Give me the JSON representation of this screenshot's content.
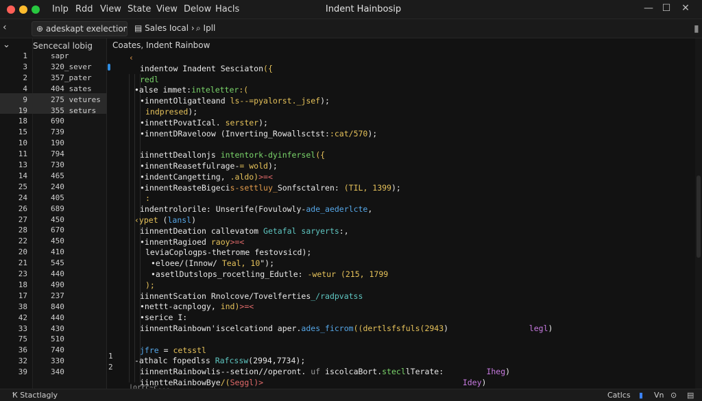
{
  "window": {
    "title": "Indent Hainbosip",
    "controls": {
      "minimize": "—",
      "maximize": "☐",
      "close": "✕"
    }
  },
  "menu": [
    "Inlp",
    "Rdd",
    "View",
    "State",
    "View",
    "Delow",
    "Hacls"
  ],
  "toolbar": {
    "back": "‹",
    "dropdown": "⊕ adeskapt exelection ▾",
    "local": "▤ Sales Iocal ›",
    "call": "⌕ Ipll",
    "right": "▮"
  },
  "sidebar": {
    "header": "Sencecal lobig",
    "chevron": "⌄",
    "rows": [
      {
        "gutter": "1",
        "val": "sapr"
      },
      {
        "gutter": "3",
        "val": "320_sever"
      },
      {
        "gutter": "2",
        "val": "357_pater"
      },
      {
        "gutter": "4",
        "val": "404 sates"
      },
      {
        "gutter": "9",
        "val": "275 vetures"
      },
      {
        "gutter": "19",
        "val": "355 seturs"
      },
      {
        "gutter": "18",
        "val": "690"
      },
      {
        "gutter": "15",
        "val": "739"
      },
      {
        "gutter": "10",
        "val": "190"
      },
      {
        "gutter": "11",
        "val": "794"
      },
      {
        "gutter": "13",
        "val": "730"
      },
      {
        "gutter": "14",
        "val": "465"
      },
      {
        "gutter": "25",
        "val": "240"
      },
      {
        "gutter": "24",
        "val": "405"
      },
      {
        "gutter": "26",
        "val": "689"
      },
      {
        "gutter": "27",
        "val": "450"
      },
      {
        "gutter": "28",
        "val": "670"
      },
      {
        "gutter": "22",
        "val": "450"
      },
      {
        "gutter": "20",
        "val": "410"
      },
      {
        "gutter": "21",
        "val": "545"
      },
      {
        "gutter": "23",
        "val": "440"
      },
      {
        "gutter": "18",
        "val": "490"
      },
      {
        "gutter": "17",
        "val": "237"
      },
      {
        "gutter": "38",
        "val": "840"
      },
      {
        "gutter": "42",
        "val": "440"
      },
      {
        "gutter": "33",
        "val": "430"
      },
      {
        "gutter": "75",
        "val": "510"
      },
      {
        "gutter": "36",
        "val": "740"
      },
      {
        "gutter": "32",
        "val": "330"
      },
      {
        "gutter": "39",
        "val": "340"
      }
    ]
  },
  "editor": {
    "header": "Coates, Indent Rainbow",
    "lines": [
      {
        "indent": 2,
        "parts": [
          {
            "t": "‹",
            "c": "o"
          }
        ]
      },
      {
        "indent": 4,
        "parts": [
          {
            "t": "indentow Inadent Sesciaton",
            "c": "w"
          },
          {
            "t": "({",
            "c": "y"
          }
        ]
      },
      {
        "indent": 4,
        "parts": [
          {
            "t": "redl",
            "c": "g"
          }
        ]
      },
      {
        "indent": 3,
        "parts": [
          {
            "t": "•alse immet:",
            "c": "w"
          },
          {
            "t": "inteletter",
            "c": "g"
          },
          {
            "t": ":(",
            "c": "y"
          }
        ]
      },
      {
        "indent": 4,
        "parts": [
          {
            "t": "•innentOligatleand ",
            "c": "w"
          },
          {
            "t": "ls--=pyalorst._jsef",
            "c": "y"
          },
          {
            "t": ");",
            "c": "w"
          }
        ]
      },
      {
        "indent": 5,
        "parts": [
          {
            "t": "indpresed",
            "c": "y"
          },
          {
            "t": ");",
            "c": "w"
          }
        ]
      },
      {
        "indent": 4,
        "parts": [
          {
            "t": "•innettPovatIcal.",
            "c": "w"
          },
          {
            "t": " serster",
            "c": "y"
          },
          {
            "t": ");",
            "c": "w"
          }
        ]
      },
      {
        "indent": 4,
        "parts": [
          {
            "t": "•innentDRaveloow (Inverting_Rowallsctst:",
            "c": "w"
          },
          {
            "t": ":cat/570",
            "c": "y"
          },
          {
            "t": ");",
            "c": "w"
          }
        ]
      },
      {
        "indent": 0,
        "parts": [
          {
            "t": "",
            "c": "w"
          }
        ]
      },
      {
        "indent": 4,
        "parts": [
          {
            "t": "iinnettDeallonjs ",
            "c": "w"
          },
          {
            "t": "intentork-dyinfersel",
            "c": "g"
          },
          {
            "t": "({",
            "c": "y"
          }
        ]
      },
      {
        "indent": 4,
        "parts": [
          {
            "t": "•innentReasetfulrage-",
            "c": "w"
          },
          {
            "t": "= wold",
            "c": "y"
          },
          {
            "t": ");",
            "c": "w"
          }
        ]
      },
      {
        "indent": 4,
        "parts": [
          {
            "t": "•indentCangetting, ",
            "c": "w"
          },
          {
            "t": ".aldo)",
            "c": "y"
          },
          {
            "t": ">=<",
            "c": "r"
          }
        ]
      },
      {
        "indent": 4,
        "parts": [
          {
            "t": "•innentReasteBigeci",
            "c": "w"
          },
          {
            "t": "s-settluy_",
            "c": "o"
          },
          {
            "t": "Sonfsctalren: ",
            "c": "w"
          },
          {
            "t": "(TIL, 1399",
            "c": "y"
          },
          {
            "t": ");",
            "c": "w"
          }
        ]
      },
      {
        "indent": 5,
        "parts": [
          {
            "t": ":",
            "c": "y"
          }
        ]
      },
      {
        "indent": 4,
        "parts": [
          {
            "t": "indentrolorile: Unserife(Fovulowly-",
            "c": "w"
          },
          {
            "t": "ade_aederlcte",
            "c": "b"
          },
          {
            "t": ",",
            "c": "w"
          }
        ]
      },
      {
        "indent": 3,
        "parts": [
          {
            "t": "‹ypet ",
            "c": "y"
          },
          {
            "t": "(",
            "c": "w"
          },
          {
            "t": "lansl",
            "c": "b"
          },
          {
            "t": ")",
            "c": "w"
          }
        ]
      },
      {
        "indent": 4,
        "parts": [
          {
            "t": "iinnentDeation callevatom ",
            "c": "w"
          },
          {
            "t": "Getafal saryerts",
            "c": "c"
          },
          {
            "t": ":,",
            "c": "w"
          }
        ]
      },
      {
        "indent": 4,
        "parts": [
          {
            "t": "•innentRagioed ",
            "c": "w"
          },
          {
            "t": "raoy",
            "c": "y"
          },
          {
            "t": ">=<",
            "c": "r"
          }
        ]
      },
      {
        "indent": 5,
        "parts": [
          {
            "t": "leviaCoplogps-thetrome festovsicd",
            "c": "w"
          },
          {
            "t": ");",
            "c": "w"
          }
        ]
      },
      {
        "indent": 6,
        "parts": [
          {
            "t": "•eloee/(Innow/ ",
            "c": "w"
          },
          {
            "t": "Teal, 10",
            "c": "y"
          },
          {
            "t": "\");",
            "c": "w"
          }
        ]
      },
      {
        "indent": 6,
        "parts": [
          {
            "t": "•asetlDutslops_rocetling_Edutle: ",
            "c": "w"
          },
          {
            "t": "-wetur (215, 1799",
            "c": "y"
          }
        ]
      },
      {
        "indent": 5,
        "parts": [
          {
            "t": ");",
            "c": "y"
          }
        ]
      },
      {
        "indent": 4,
        "parts": [
          {
            "t": "iinnentScation Rnolcove/Tovelferties",
            "c": "w"
          },
          {
            "t": "_/radpvatss",
            "c": "c"
          }
        ]
      },
      {
        "indent": 4,
        "parts": [
          {
            "t": "•nettt-acnplogy, ",
            "c": "w"
          },
          {
            "t": "ind)",
            "c": "y"
          },
          {
            "t": ">=<",
            "c": "r"
          }
        ]
      },
      {
        "indent": 4,
        "parts": [
          {
            "t": "•serice I:",
            "c": "w"
          }
        ]
      },
      {
        "indent": 4,
        "parts": [
          {
            "t": "iinnentRainbown",
            "c": "w"
          },
          {
            "t": "'iscelcationd aper.",
            "c": "w"
          },
          {
            "t": "ades_ficrom",
            "c": "b"
          },
          {
            "t": "((dertlsfsfuls(2943",
            "c": "y"
          },
          {
            "t": ")",
            "c": "w"
          },
          {
            "t": "                 legl",
            "c": "p"
          },
          {
            "t": ")",
            "c": "w"
          }
        ]
      },
      {
        "indent": 0,
        "parts": [
          {
            "t": "",
            "c": "w"
          }
        ]
      },
      {
        "indent": 4,
        "parts": [
          {
            "t": "jfre",
            "c": "b"
          },
          {
            "t": " = ",
            "c": "w"
          },
          {
            "t": "cetsstl",
            "c": "y"
          }
        ]
      },
      {
        "indent": 3,
        "parts": [
          {
            "t": "-athalc fopedlss ",
            "c": "w"
          },
          {
            "t": "Rafcssw",
            "c": "c"
          },
          {
            "t": "(2994,7734);",
            "c": "w"
          }
        ]
      },
      {
        "indent": 4,
        "parts": [
          {
            "t": "iinnentRainbowlis--setion//operont.",
            "c": "w"
          },
          {
            "t": " uf ",
            "c": "gr"
          },
          {
            "t": "iscolcaBort.",
            "c": "w"
          },
          {
            "t": "stecl",
            "c": "g"
          },
          {
            "t": "lTerate:",
            "c": "w"
          },
          {
            "t": "         Iheg",
            "c": "p"
          },
          {
            "t": ")",
            "c": "w"
          }
        ]
      },
      {
        "indent": 4,
        "parts": [
          {
            "t": "iinntteRainbowBye",
            "c": "w"
          },
          {
            "t": "/(",
            "c": "y"
          },
          {
            "t": "Seggl",
            "c": "r"
          },
          {
            "t": ")>",
            "c": "r"
          },
          {
            "t": "                                          Idey",
            "c": "p"
          },
          {
            "t": ")",
            "c": "w"
          }
        ]
      }
    ],
    "marker_left": [
      "1",
      "2"
    ],
    "bottom_hint": "|orrc~c..."
  },
  "status": {
    "left": "Ҟ Stactlagly",
    "right_cancel": "Catlcs",
    "right_lang": "Vn",
    "bell": "⊙"
  }
}
